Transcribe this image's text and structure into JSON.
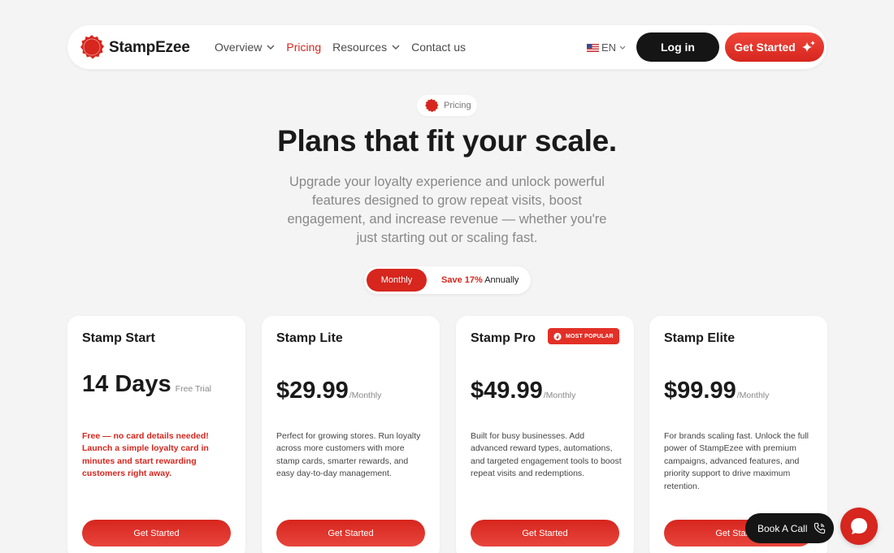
{
  "nav": {
    "brand": "StampEzee",
    "menu": [
      {
        "label": "Overview",
        "dropdown": true,
        "active": false
      },
      {
        "label": "Pricing",
        "dropdown": false,
        "active": true
      },
      {
        "label": "Resources",
        "dropdown": true,
        "active": false
      },
      {
        "label": "Contact us",
        "dropdown": false,
        "active": false
      }
    ],
    "language": "EN",
    "login_label": "Log in",
    "get_started_label": "Get Started"
  },
  "hero": {
    "pill_label": "Pricing",
    "title": "Plans that fit your scale.",
    "subtitle": "Upgrade your loyalty experience and unlock powerful features designed to grow repeat visits, boost engagement, and increase revenue — whether you're just starting out or scaling fast."
  },
  "billing_toggle": {
    "monthly_label": "Monthly",
    "annual_save": "Save 17%",
    "annual_label": "Annually",
    "selected": "Monthly"
  },
  "plans": [
    {
      "name": "Stamp Start",
      "price": "14 Days",
      "period": "Free Trial",
      "description": "Free — no card details needed! Launch a simple loyalty card in minutes and start rewarding customers right away.",
      "button": "Get Started",
      "badge": ""
    },
    {
      "name": "Stamp Lite",
      "price": "$29.99",
      "period": "/Monthly",
      "description": "Perfect for growing stores. Run loyalty across more customers with more stamp cards, smarter rewards, and easy day-to-day management.",
      "button": "Get Started",
      "badge": ""
    },
    {
      "name": "Stamp Pro",
      "price": "$49.99",
      "period": "/Monthly",
      "description": "Built for busy businesses. Add advanced reward types, automations, and targeted engagement tools to boost repeat visits and redemptions.",
      "button": "Get Started",
      "badge": "MOST POPULAR"
    },
    {
      "name": "Stamp Elite",
      "price": "$99.99",
      "period": "/Monthly",
      "description": "For brands scaling fast. Unlock the full power of StampEzee with premium campaigns, advanced features, and priority support to drive maximum retention.",
      "button": "Get Started",
      "badge": ""
    }
  ],
  "floating": {
    "book_call_label": "Book A Call"
  },
  "colors": {
    "accent": "#d6261e",
    "dark": "#151515",
    "background": "#f4f4f4"
  },
  "icons": [
    "seal-logo-icon",
    "chevron-down-icon",
    "us-flag-icon",
    "sparkle-icon",
    "fire-icon",
    "phone-icon",
    "chat-bubble-icon"
  ]
}
